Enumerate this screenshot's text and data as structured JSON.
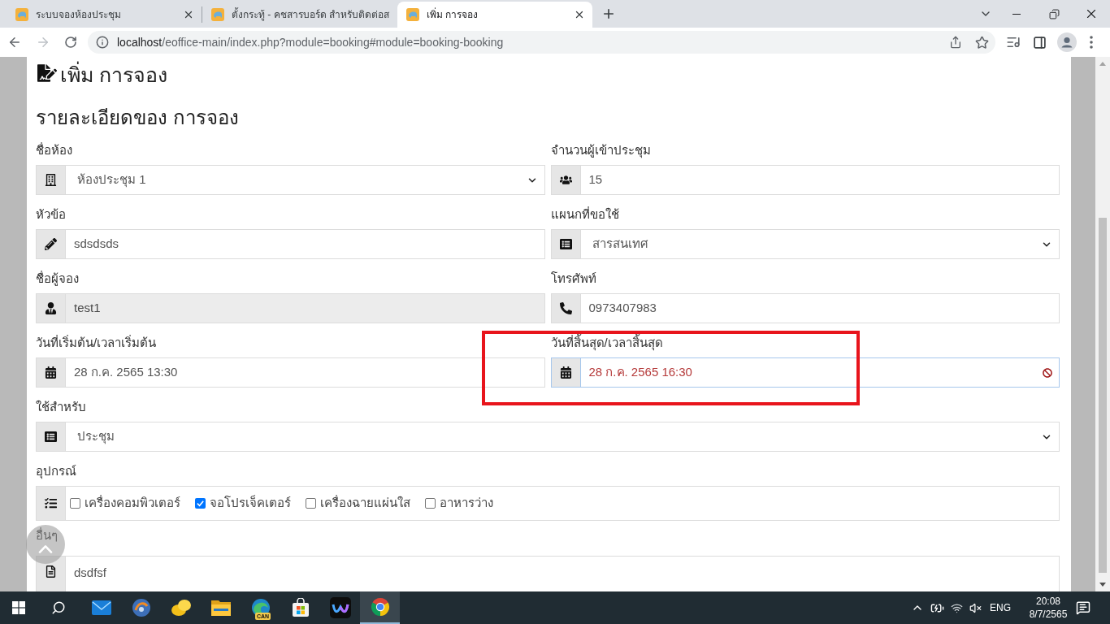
{
  "browser": {
    "tabs": [
      {
        "title": "ระบบจองห้องประชุม",
        "selected": false
      },
      {
        "title": "ตั้งกระทู้ - คชสารบอร์ด สำหรับติดต่อส",
        "selected": false
      },
      {
        "title": "เพิ่ม การจอง",
        "selected": true
      }
    ],
    "url_host": "localhost",
    "url_path": "/eoffice-main/index.php?module=booking#module=booking-booking"
  },
  "page": {
    "title": "เพิ่ม การจอง",
    "section_title": "รายละเอียดของ การจอง"
  },
  "form": {
    "rows": [
      [
        {
          "label": "ชื่อห้อง",
          "kind": "select",
          "value": "ห้องประชุม 1",
          "readonly": false,
          "invalid": false
        },
        {
          "label": "จำนวนผู้เข้าประชุม",
          "kind": "text",
          "value": "15",
          "readonly": false,
          "invalid": false
        }
      ],
      [
        {
          "label": "หัวข้อ",
          "kind": "text",
          "value": "sdsdsds",
          "readonly": false,
          "invalid": false
        },
        {
          "label": "แผนกที่ขอใช้",
          "kind": "select",
          "value": "สารสนเทศ",
          "readonly": false,
          "invalid": false
        }
      ],
      [
        {
          "label": "ชื่อผู้จอง",
          "kind": "text",
          "value": "test1",
          "readonly": true,
          "invalid": false
        },
        {
          "label": "โทรศัพท์",
          "kind": "text",
          "value": "0973407983",
          "readonly": false,
          "invalid": false
        }
      ],
      [
        {
          "label": "วันที่เริ่มต้น/เวลาเริ่มต้น",
          "kind": "date",
          "value": "28 ก.ค. 2565 13:30",
          "readonly": false,
          "invalid": false
        },
        {
          "label": "วันที่สิ้นสุด/เวลาสิ้นสุด",
          "kind": "date",
          "value": "28 ก.ค. 2565 16:30",
          "readonly": false,
          "invalid": true
        }
      ],
      [
        {
          "label": "ใช้สำหรับ",
          "kind": "select",
          "value": "ประชุม",
          "readonly": false,
          "invalid": false
        }
      ],
      [
        {
          "label": "อุปกรณ์",
          "kind": "checkboxes",
          "options": [
            {
              "label": "เครื่องคอมพิวเตอร์",
              "checked": false
            },
            {
              "label": "จอโปรเจ็คเตอร์",
              "checked": true
            },
            {
              "label": "เครื่องฉายแผ่นใส",
              "checked": false
            },
            {
              "label": "อาหารว่าง",
              "checked": false
            }
          ]
        }
      ],
      [
        {
          "label": "อื่นๆ",
          "kind": "textarea",
          "value": "dsdfsf",
          "readonly": false,
          "invalid": false
        }
      ]
    ]
  },
  "taskbar": {
    "apps": [
      {
        "active": false
      },
      {
        "active": false
      },
      {
        "active": false
      },
      {
        "active": false
      },
      {
        "active": false,
        "badge": "CAN"
      },
      {
        "active": false
      },
      {
        "active": false
      },
      {
        "active": true
      }
    ],
    "language": "ENG",
    "time": "20:08",
    "date": "8/7/2565"
  }
}
